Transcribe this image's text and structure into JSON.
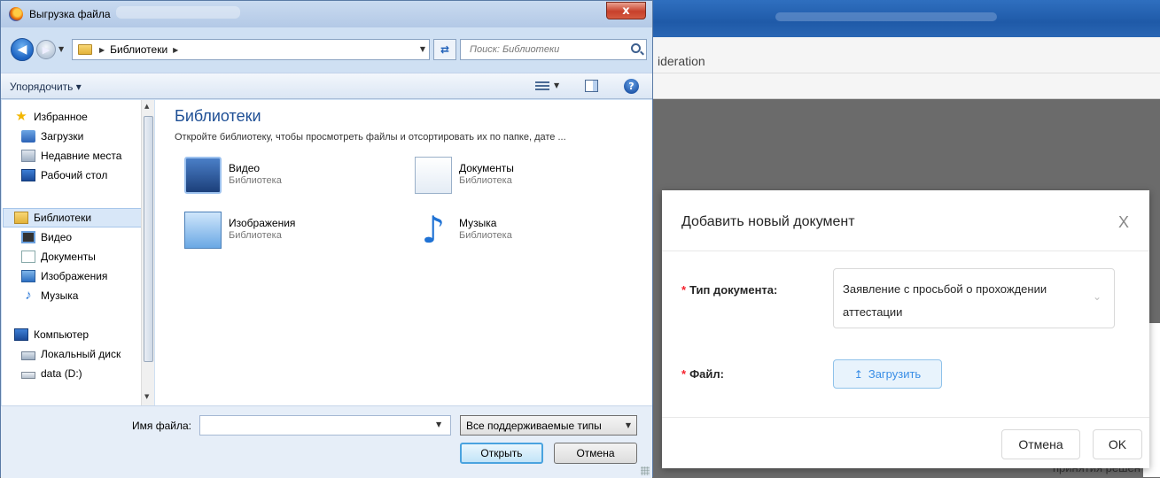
{
  "background_browser": {
    "tab_fragment": "ideration",
    "bottom_text": "принятия решен"
  },
  "modal": {
    "title": "Добавить новый документ",
    "close_symbol": "X",
    "doc_type_label": "Тип документа:",
    "doc_type_value": "Заявление с просьбой о прохождении аттестации",
    "file_label": "Файл:",
    "upload_label": "Загрузить",
    "cancel_label": "Отмена",
    "ok_label": "OK",
    "required_mark": "*"
  },
  "dialog": {
    "title": "Выгрузка файла",
    "close_symbol": "x",
    "address": "Библиотеки",
    "search_placeholder": "Поиск: Библиотеки",
    "organize_label": "Упорядочить ▾",
    "help_symbol": "?",
    "nav": {
      "favorites": "Избранное",
      "downloads": "Загрузки",
      "recent": "Недавние места",
      "desktop": "Рабочий стол",
      "libraries": "Библиотеки",
      "video": "Видео",
      "documents": "Документы",
      "images": "Изображения",
      "music": "Музыка",
      "computer": "Компьютер",
      "local_disk": "Локальный диск",
      "data_drive": "data (D:)"
    },
    "content": {
      "heading": "Библиотеки",
      "subtitle": "Откройте библиотеку, чтобы просмотреть файлы и отсортировать их по папке, дате ...",
      "library_type": "Библиотека",
      "tiles": [
        {
          "name": "Видео",
          "type": "Библиотека"
        },
        {
          "name": "Документы",
          "type": "Библиотека"
        },
        {
          "name": "Изображения",
          "type": "Библиотека"
        },
        {
          "name": "Музыка",
          "type": "Библиотека"
        }
      ]
    },
    "filename_label": "Имя файла:",
    "filename_value": "",
    "filter_value": "Все поддерживаемые типы",
    "open_label": "Открыть",
    "cancel_label": "Отмена"
  }
}
